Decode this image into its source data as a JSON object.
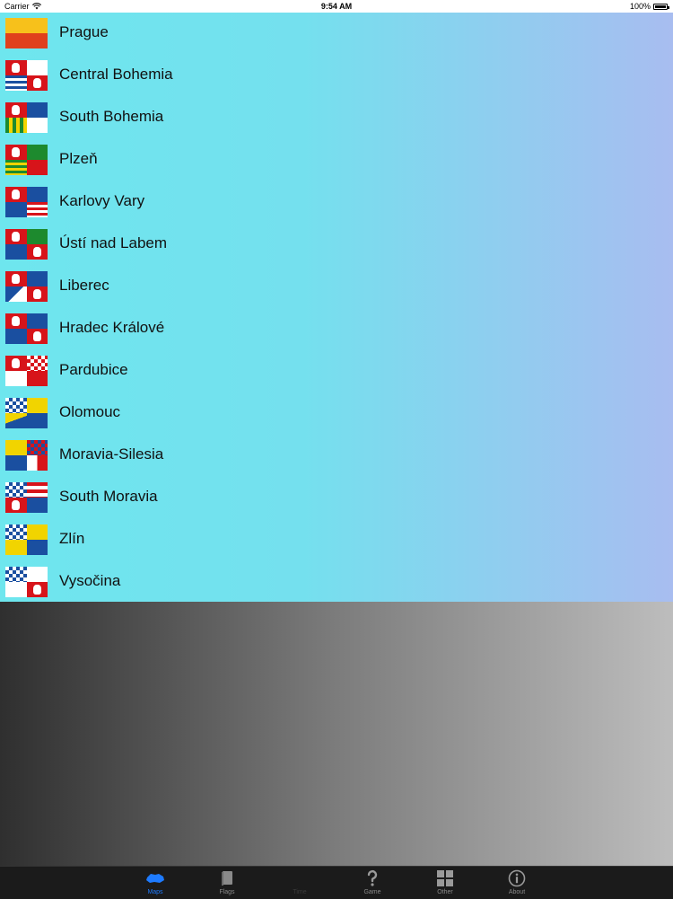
{
  "status": {
    "carrier": "Carrier",
    "time": "9:54 AM",
    "battery": "100%"
  },
  "regions": [
    {
      "label": "Prague"
    },
    {
      "label": "Central Bohemia"
    },
    {
      "label": "South Bohemia"
    },
    {
      "label": "Plzeň"
    },
    {
      "label": "Karlovy Vary"
    },
    {
      "label": "Ústí nad Labem"
    },
    {
      "label": "Liberec"
    },
    {
      "label": "Hradec Králové"
    },
    {
      "label": "Pardubice"
    },
    {
      "label": "Olomouc"
    },
    {
      "label": "Moravia-Silesia"
    },
    {
      "label": "South Moravia"
    },
    {
      "label": "Zlín"
    },
    {
      "label": "Vysočina"
    }
  ],
  "tabs": [
    {
      "label": "Maps",
      "icon": "czech-map-icon",
      "state": "active"
    },
    {
      "label": "Flags",
      "icon": "book-icon",
      "state": "normal"
    },
    {
      "label": "Time",
      "icon": "",
      "state": "disabled"
    },
    {
      "label": "Game",
      "icon": "question-icon",
      "state": "normal"
    },
    {
      "label": "Other",
      "icon": "grid-icon",
      "state": "normal"
    },
    {
      "label": "About",
      "icon": "info-icon",
      "state": "normal"
    }
  ],
  "colors": {
    "accent": "#1e7bff",
    "list_gradient_start": "#6ee6ee",
    "list_gradient_end": "#a8bdf0"
  }
}
